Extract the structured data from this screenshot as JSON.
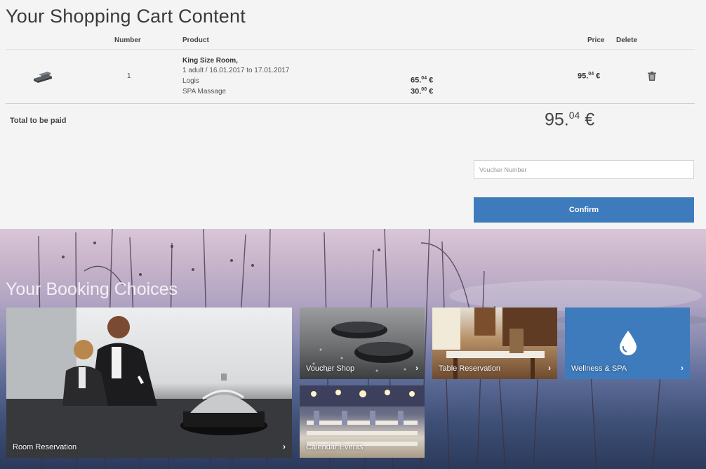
{
  "cart": {
    "title": "Your Shopping Cart Content",
    "columns": {
      "number": "Number",
      "product": "Product",
      "price": "Price",
      "delete": "Delete"
    },
    "item": {
      "icon": "bed-icon",
      "number": "1",
      "product_name": "King Size Room,",
      "product_details": "1 adult / 16.01.2017 to 17.01.2017",
      "lines": [
        {
          "label": "Logis",
          "amount_main": "65.",
          "amount_cents": "04",
          "currency": "€"
        },
        {
          "label": "SPA Massage",
          "amount_main": "30.",
          "amount_cents": "00",
          "currency": "€"
        }
      ],
      "price_main": "95.",
      "price_cents": "04",
      "currency": "€",
      "delete_icon": "trash-icon"
    },
    "total": {
      "label": "Total to be paid",
      "main": "95.",
      "cents": "04",
      "currency": "€"
    },
    "voucher": {
      "placeholder": "Voucher Number",
      "value": ""
    },
    "confirm_label": "Confirm",
    "accent_color": "#3e7bbd"
  },
  "booking": {
    "title": "Your Booking Choices",
    "tiles": [
      {
        "label": "Room Reservation",
        "arrow": "›"
      },
      {
        "label": "Voucher Shop",
        "arrow": "›"
      },
      {
        "label": "Table Reservation",
        "arrow": "›"
      },
      {
        "label": "Wellness & SPA",
        "arrow": "›",
        "icon": "water-drop-icon"
      },
      {
        "label": "Calendar Events",
        "arrow": "›"
      }
    ]
  }
}
